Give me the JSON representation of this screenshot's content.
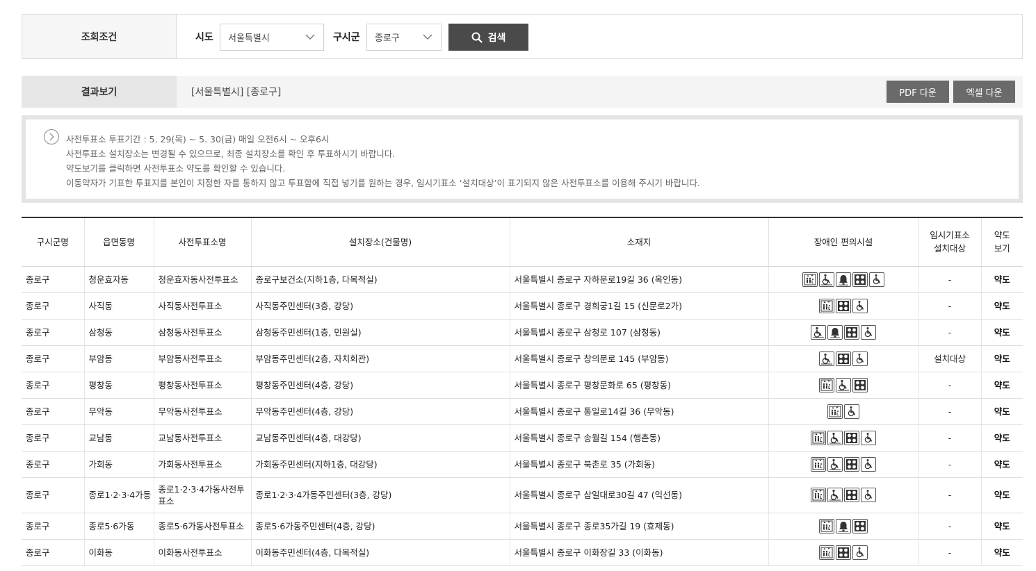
{
  "search": {
    "label": "조회조건",
    "sido_label": "시도",
    "sido_value": "서울특별시",
    "sigungu_label": "구시군",
    "sigungu_value": "종로구",
    "button_label": "검색"
  },
  "result": {
    "label": "결과보기",
    "text": "[서울특별시] [종로구]",
    "pdf_label": "PDF 다운",
    "excel_label": "엑셀 다운"
  },
  "notice": [
    "사전투표소 투표기간 : 5. 29(목) ~ 5. 30(금) 매일 오전6시 ~ 오후6시",
    "사전투표소 설치장소는 변경될 수 있으므로, 최종 설치장소를 확인 후 투표하시기 바랍니다.",
    "약도보기를 클릭하면 사전투표소 약도를 확인할 수 있습니다.",
    "이동약자가 기표한 투표지를 본인이 지정한 자를 통하지 않고 투표함에 직접 넣기를 원하는 경우, 임시기표소 ‘설치대상’이 표기되지 않은 사전투표소를 이용해 주시기 바랍니다."
  ],
  "table": {
    "headers": {
      "sigungu": "구시군명",
      "eup": "읍면동명",
      "station": "사전투표소명",
      "place": "설치장소(건물명)",
      "address": "소재지",
      "facility": "장애인 편의시설",
      "temp_1": "임시기표소",
      "temp_2": "설치대상",
      "map_1": "약도",
      "map_2": "보기"
    },
    "rows": [
      {
        "sigungu": "종로구",
        "eup": "청운효자동",
        "station": "청운효자동사전투표소",
        "place": "종로구보건소(지하1층, 다목적실)",
        "address": "서울특별시 종로구 자하문로19길 36 (옥인동)",
        "icons": [
          "elevator-icon",
          "wheelchair-ramp-icon",
          "bell-icon",
          "braille-icon",
          "wheelchair-icon"
        ],
        "temp": "-",
        "map": "약도"
      },
      {
        "sigungu": "종로구",
        "eup": "사직동",
        "station": "사직동사전투표소",
        "place": "사직동주민센터(3층, 강당)",
        "address": "서울특별시 종로구 경희궁1길 15 (신문로2가)",
        "icons": [
          "elevator-icon",
          "braille-icon",
          "wheelchair-icon"
        ],
        "temp": "-",
        "map": "약도"
      },
      {
        "sigungu": "종로구",
        "eup": "삼청동",
        "station": "삼청동사전투표소",
        "place": "삼청동주민센터(1층, 민원실)",
        "address": "서울특별시 종로구 삼청로 107 (삼청동)",
        "icons": [
          "wheelchair-ramp-icon",
          "bell-icon",
          "braille-icon",
          "wheelchair-icon"
        ],
        "temp": "-",
        "map": "약도"
      },
      {
        "sigungu": "종로구",
        "eup": "부암동",
        "station": "부암동사전투표소",
        "place": "부암동주민센터(2층, 자치회관)",
        "address": "서울특별시 종로구 창의문로 145 (부암동)",
        "icons": [
          "wheelchair-ramp-icon",
          "braille-icon",
          "wheelchair-icon"
        ],
        "temp": "설치대상",
        "map": "약도"
      },
      {
        "sigungu": "종로구",
        "eup": "평창동",
        "station": "평창동사전투표소",
        "place": "평창동주민센터(4층, 강당)",
        "address": "서울특별시 종로구 평창문화로 65 (평창동)",
        "icons": [
          "elevator-icon",
          "wheelchair-ramp-icon",
          "braille-icon"
        ],
        "temp": "-",
        "map": "약도"
      },
      {
        "sigungu": "종로구",
        "eup": "무악동",
        "station": "무악동사전투표소",
        "place": "무악동주민센터(4층, 강당)",
        "address": "서울특별시 종로구 통일로14길 36 (무악동)",
        "icons": [
          "elevator-icon",
          "wheelchair-icon"
        ],
        "temp": "-",
        "map": "약도"
      },
      {
        "sigungu": "종로구",
        "eup": "교남동",
        "station": "교남동사전투표소",
        "place": "교남동주민센터(4층, 대강당)",
        "address": "서울특별시 종로구 송월길 154 (행촌동)",
        "icons": [
          "elevator-icon",
          "wheelchair-ramp-icon",
          "braille-icon",
          "wheelchair-icon"
        ],
        "temp": "-",
        "map": "약도"
      },
      {
        "sigungu": "종로구",
        "eup": "가회동",
        "station": "가회동사전투표소",
        "place": "가회동주민센터(지하1층, 대강당)",
        "address": "서울특별시 종로구 북촌로 35 (가회동)",
        "icons": [
          "elevator-icon",
          "wheelchair-ramp-icon",
          "braille-icon",
          "wheelchair-icon"
        ],
        "temp": "-",
        "map": "약도"
      },
      {
        "sigungu": "종로구",
        "eup": "종로1·2·3·4가동",
        "station": "종로1·2·3·4가동사전투표소",
        "place": "종로1·2·3·4가동주민센터(3층, 강당)",
        "address": "서울특별시 종로구 삼일대로30길 47 (익선동)",
        "icons": [
          "elevator-icon",
          "wheelchair-ramp-icon",
          "braille-icon",
          "wheelchair-icon"
        ],
        "temp": "-",
        "map": "약도",
        "tall": true
      },
      {
        "sigungu": "종로구",
        "eup": "종로5·6가동",
        "station": "종로5·6가동사전투표소",
        "place": "종로5·6가동주민센터(4층, 강당)",
        "address": "서울특별시 종로구 종로35가길 19 (효제동)",
        "icons": [
          "elevator-icon",
          "bell-icon",
          "braille-icon"
        ],
        "temp": "-",
        "map": "약도"
      },
      {
        "sigungu": "종로구",
        "eup": "이화동",
        "station": "이화동사전투표소",
        "place": "이화동주민센터(4층, 다목적실)",
        "address": "서울특별시 종로구 이화장길 33 (이화동)",
        "icons": [
          "elevator-icon",
          "braille-icon",
          "wheelchair-icon"
        ],
        "temp": "-",
        "map": "약도"
      }
    ]
  }
}
